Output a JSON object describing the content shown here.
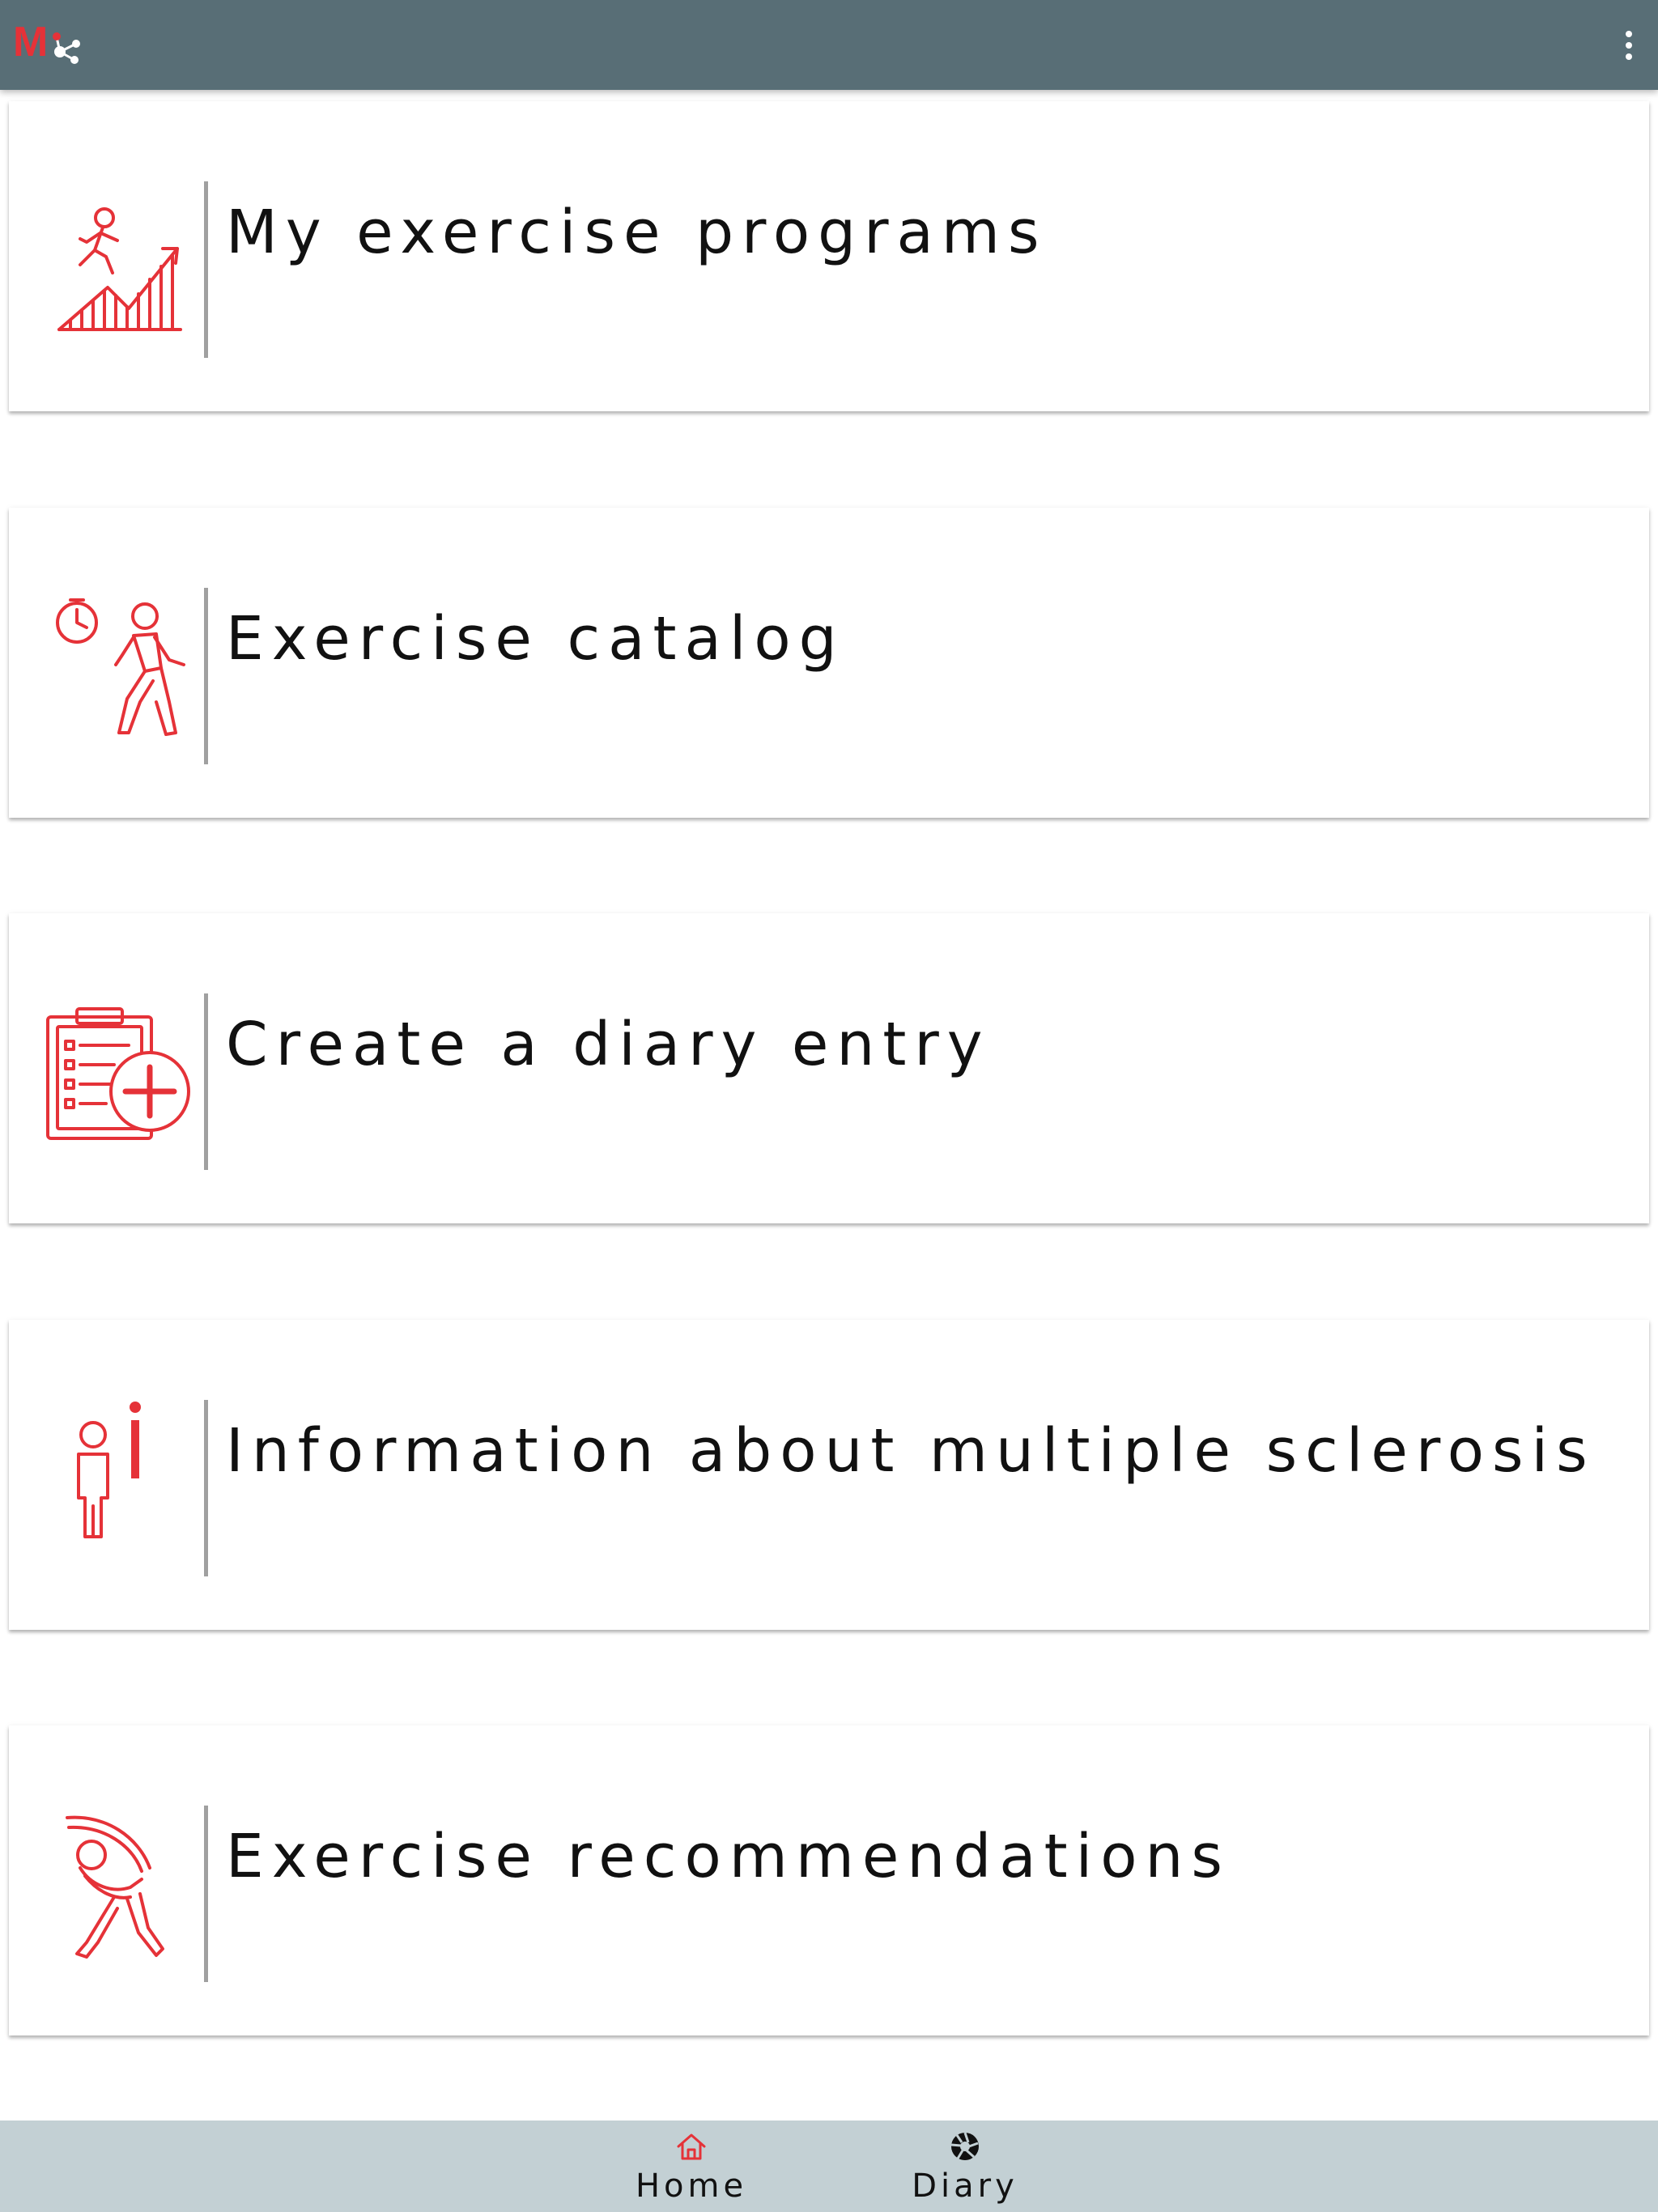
{
  "appbar": {
    "logo_text": "M",
    "menu_icon": "more-vert-icon",
    "bg_color": "#586e76"
  },
  "menu": {
    "items": [
      {
        "label": "My exercise programs",
        "icon": "runner-progress-chart-icon"
      },
      {
        "label": "Exercise catalog",
        "icon": "walker-stopwatch-icon"
      },
      {
        "label": "Create a diary entry",
        "icon": "clipboard-add-icon"
      },
      {
        "label": "Information about multiple sclerosis",
        "icon": "person-info-icon"
      },
      {
        "label": "Exercise recommendations",
        "icon": "stretching-person-icon"
      }
    ],
    "accent_color": "#e53238"
  },
  "bottom_nav": {
    "tabs": [
      {
        "label": "Home",
        "icon": "home-icon",
        "active": true
      },
      {
        "label": "Diary",
        "icon": "aperture-icon",
        "active": false
      }
    ],
    "bg_color": "#c3d0d4"
  }
}
